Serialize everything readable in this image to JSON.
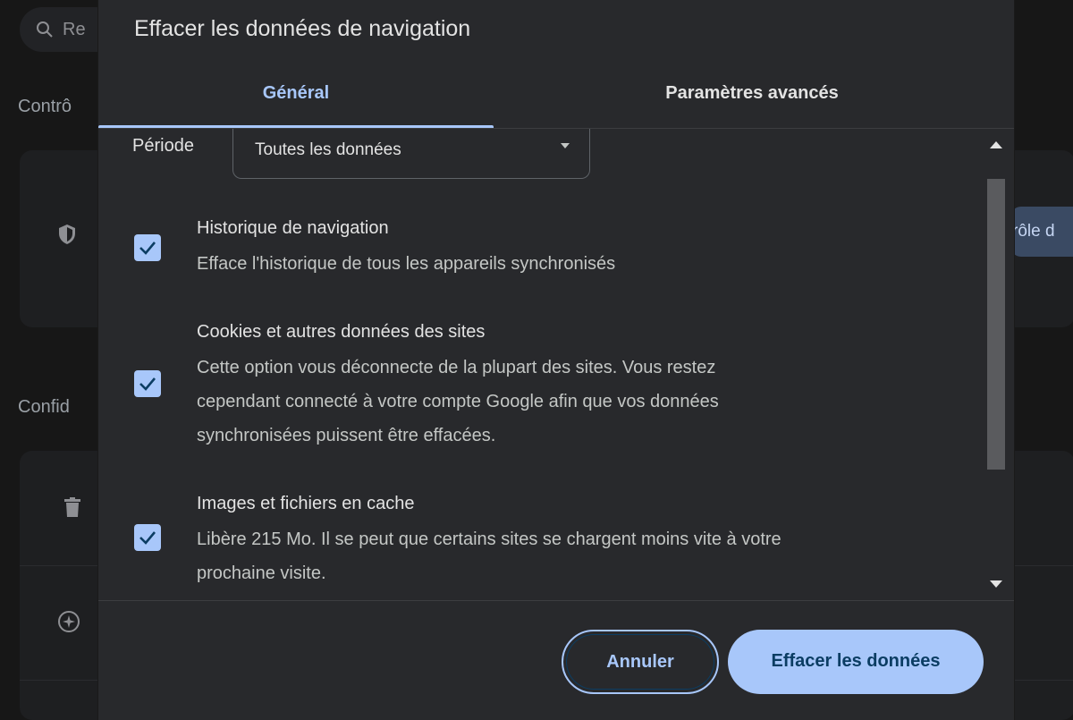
{
  "background": {
    "search_text": "Re",
    "section_1": "Contrô",
    "section_2": "Confid",
    "right_button_text": "rôle d"
  },
  "dialog": {
    "title": "Effacer les données de navigation",
    "tabs": [
      {
        "label": "Général",
        "active": true
      },
      {
        "label": "Paramètres avancés",
        "active": false
      }
    ],
    "period": {
      "label": "Période",
      "value": "Toutes les données"
    },
    "options": [
      {
        "title": "Historique de navigation",
        "description": "Efface l'historique de tous les appareils synchronisés",
        "checked": true
      },
      {
        "title": "Cookies et autres données des sites",
        "description_lines": [
          "Cette option vous déconnecte de la plupart des sites. Vous restez",
          "cependant connecté à votre compte Google afin que vos données",
          "synchronisées puissent être effacées."
        ],
        "checked": true
      },
      {
        "title": "Images et fichiers en cache",
        "description_lines": [
          "Libère 215 Mo. Il se peut que certains sites se chargent moins vite à votre",
          "prochaine visite."
        ],
        "checked": true
      }
    ],
    "buttons": {
      "cancel": "Annuler",
      "confirm": "Effacer les données"
    }
  },
  "colors": {
    "accent": "#a8c7fa",
    "dialog_bg": "#28292c",
    "button_text_dark": "#0b3d63"
  }
}
